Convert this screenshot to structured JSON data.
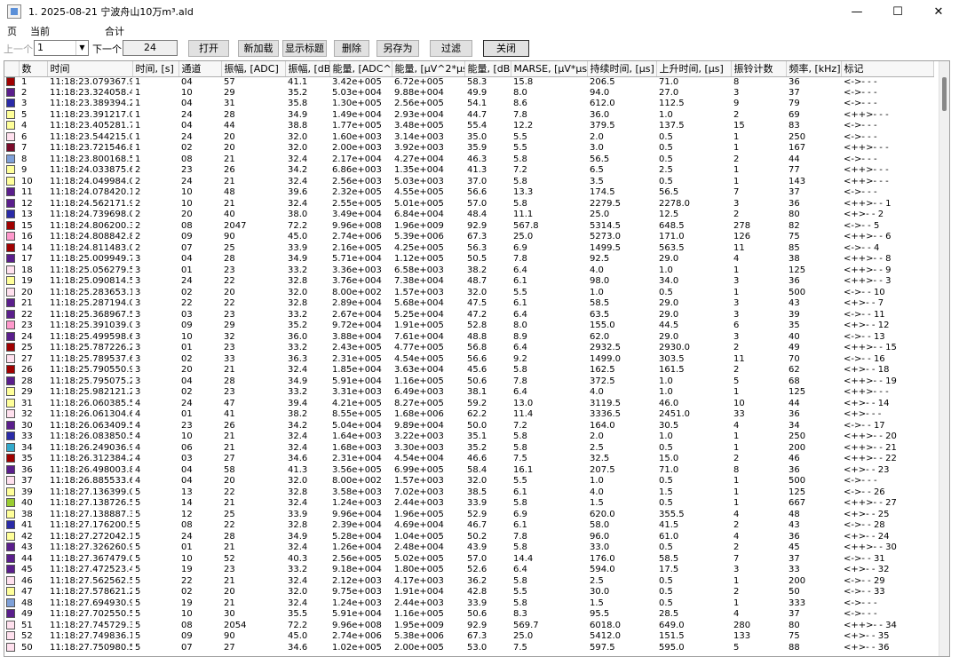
{
  "window": {
    "title": "1. 2025-08-21 宁波舟山10万m³.ald",
    "minimize": "—",
    "maximize": "☐",
    "close": "✕"
  },
  "menu": {
    "page": "页",
    "current": "当前",
    "total": "合计"
  },
  "toolbar": {
    "prev": "上一个",
    "current_value": "1",
    "next": "下一个",
    "total_value": "24",
    "open": "打开",
    "reload": "新加载",
    "show_title": "显示标题",
    "delete": "删除",
    "save_as": "另存为",
    "filter": "过滤",
    "close": "关闭"
  },
  "columns": [
    "数",
    "时间",
    "时间, [s]",
    "通道",
    "振幅, [ADC]",
    "振幅, [dB]",
    "能量, [ADC^2]",
    "能量, [µV^2*µs]",
    "能量, [dB]",
    "MARSE, [µV*µs]",
    "持续时间, [µs]",
    "上升时间, [µs]",
    "振铃计数",
    "频率, [kHz]",
    "标记"
  ],
  "rows": [
    {
      "color": "#a00000",
      "c": [
        "1",
        "11:18:23.079367.9",
        "1",
        "04",
        "57",
        "41.1",
        "3.42e+005",
        "6.72e+005",
        "58.3",
        "15.8",
        "206.5",
        "71.0",
        "8",
        "36",
        "<->- - -"
      ]
    },
    {
      "color": "#5a1e8c",
      "c": [
        "2",
        "11:18:23.324058.4",
        "1",
        "10",
        "29",
        "35.2",
        "5.03e+004",
        "9.88e+004",
        "49.9",
        "8.0",
        "94.0",
        "27.0",
        "3",
        "37",
        "<->- - -"
      ]
    },
    {
      "color": "#2a2aa8",
      "c": [
        "3",
        "11:18:23.389394.2",
        "1",
        "04",
        "31",
        "35.8",
        "1.30e+005",
        "2.56e+005",
        "54.1",
        "8.6",
        "612.0",
        "112.5",
        "9",
        "79",
        "<->- - -"
      ]
    },
    {
      "color": "#ffff99",
      "c": [
        "5",
        "11:18:23.391217.0",
        "1",
        "24",
        "28",
        "34.9",
        "1.49e+004",
        "2.93e+004",
        "44.7",
        "7.8",
        "36.0",
        "1.0",
        "2",
        "69",
        "<++>- - -"
      ]
    },
    {
      "color": "#ffff99",
      "c": [
        "4",
        "11:18:23.405281.7",
        "1",
        "04",
        "44",
        "38.8",
        "1.77e+005",
        "3.48e+005",
        "55.4",
        "12.2",
        "379.5",
        "137.5",
        "15",
        "83",
        "<->- - -"
      ]
    },
    {
      "color": "#ffe0ee",
      "c": [
        "6",
        "11:18:23.544215.0",
        "1",
        "24",
        "20",
        "32.0",
        "1.60e+003",
        "3.14e+003",
        "35.0",
        "5.5",
        "2.0",
        "0.5",
        "1",
        "250",
        "<->- - -"
      ]
    },
    {
      "color": "#7a0a2a",
      "c": [
        "7",
        "11:18:23.721546.8",
        "1",
        "02",
        "20",
        "32.0",
        "2.00e+003",
        "3.92e+003",
        "35.9",
        "5.5",
        "3.0",
        "0.5",
        "1",
        "167",
        "<++>- - -"
      ]
    },
    {
      "color": "#7ea0d8",
      "c": [
        "8",
        "11:18:23.800168.5",
        "1",
        "08",
        "21",
        "32.4",
        "2.17e+004",
        "4.27e+004",
        "46.3",
        "5.8",
        "56.5",
        "0.5",
        "2",
        "44",
        "<->- - -"
      ]
    },
    {
      "color": "#ffff99",
      "c": [
        "9",
        "11:18:24.033875.6",
        "2",
        "23",
        "26",
        "34.2",
        "6.86e+003",
        "1.35e+004",
        "41.3",
        "7.2",
        "6.5",
        "2.5",
        "1",
        "77",
        "<++>- - -"
      ]
    },
    {
      "color": "#ffff99",
      "c": [
        "10",
        "11:18:24.049984.0",
        "2",
        "24",
        "21",
        "32.4",
        "2.56e+003",
        "5.03e+003",
        "37.0",
        "5.8",
        "3.5",
        "0.5",
        "1",
        "143",
        "<++>- - -"
      ]
    },
    {
      "color": "#5a1e8c",
      "c": [
        "11",
        "11:18:24.078420.1",
        "2",
        "10",
        "48",
        "39.6",
        "2.32e+005",
        "4.55e+005",
        "56.6",
        "13.3",
        "174.5",
        "56.5",
        "7",
        "37",
        "<->- - -"
      ]
    },
    {
      "color": "#5a1e8c",
      "c": [
        "12",
        "11:18:24.562171.9",
        "2",
        "10",
        "21",
        "32.4",
        "2.55e+005",
        "5.01e+005",
        "57.0",
        "5.8",
        "2279.5",
        "2278.0",
        "3",
        "36",
        "<++>- - 1"
      ]
    },
    {
      "color": "#2a2aa8",
      "c": [
        "13",
        "11:18:24.739698.0",
        "2",
        "20",
        "40",
        "38.0",
        "3.49e+004",
        "6.84e+004",
        "48.4",
        "11.1",
        "25.0",
        "12.5",
        "2",
        "80",
        "<+>- - 2"
      ]
    },
    {
      "color": "#a00000",
      "c": [
        "15",
        "11:18:24.806200.3",
        "2",
        "08",
        "2047",
        "72.2",
        "9.96e+008",
        "1.96e+009",
        "92.9",
        "567.8",
        "5314.5",
        "648.5",
        "278",
        "82",
        "<->- - 5"
      ]
    },
    {
      "color": "#ff99cc",
      "c": [
        "16",
        "11:18:24.808842.8",
        "2",
        "09",
        "90",
        "45.0",
        "2.74e+006",
        "5.39e+006",
        "67.3",
        "25.0",
        "5273.0",
        "171.0",
        "126",
        "75",
        "<++>- - 6"
      ]
    },
    {
      "color": "#a00000",
      "c": [
        "14",
        "11:18:24.811483.0",
        "2",
        "07",
        "25",
        "33.9",
        "2.16e+005",
        "4.25e+005",
        "56.3",
        "6.9",
        "1499.5",
        "563.5",
        "11",
        "85",
        "<->- - 4"
      ]
    },
    {
      "color": "#5a1e8c",
      "c": [
        "17",
        "11:18:25.009949.7",
        "3",
        "04",
        "28",
        "34.9",
        "5.71e+004",
        "1.12e+005",
        "50.5",
        "7.8",
        "92.5",
        "29.0",
        "4",
        "38",
        "<++>- - 8"
      ]
    },
    {
      "color": "#ffe0ee",
      "c": [
        "18",
        "11:18:25.056279.5",
        "3",
        "01",
        "23",
        "33.2",
        "3.36e+003",
        "6.58e+003",
        "38.2",
        "6.4",
        "4.0",
        "1.0",
        "1",
        "125",
        "<++>- - 9"
      ]
    },
    {
      "color": "#ffff99",
      "c": [
        "19",
        "11:18:25.090814.5",
        "3",
        "24",
        "22",
        "32.8",
        "3.76e+004",
        "7.38e+004",
        "48.7",
        "6.1",
        "98.0",
        "34.0",
        "3",
        "36",
        "<++>- - 3"
      ]
    },
    {
      "color": "#ffe0ee",
      "c": [
        "20",
        "11:18:25.283653.1",
        "3",
        "02",
        "20",
        "32.0",
        "8.00e+002",
        "1.57e+003",
        "32.0",
        "5.5",
        "1.0",
        "0.5",
        "1",
        "500",
        "<->- - 10"
      ]
    },
    {
      "color": "#5a1e8c",
      "c": [
        "21",
        "11:18:25.287194.0",
        "3",
        "22",
        "22",
        "32.8",
        "2.89e+004",
        "5.68e+004",
        "47.5",
        "6.1",
        "58.5",
        "29.0",
        "3",
        "43",
        "<+>- - 7"
      ]
    },
    {
      "color": "#5a1e8c",
      "c": [
        "22",
        "11:18:25.368967.5",
        "3",
        "03",
        "23",
        "33.2",
        "2.67e+004",
        "5.25e+004",
        "47.2",
        "6.4",
        "63.5",
        "29.0",
        "3",
        "39",
        "<->- - 11"
      ]
    },
    {
      "color": "#ff99cc",
      "c": [
        "23",
        "11:18:25.391039.0",
        "3",
        "09",
        "29",
        "35.2",
        "9.72e+004",
        "1.91e+005",
        "52.8",
        "8.0",
        "155.0",
        "44.5",
        "6",
        "35",
        "<+>- - 12"
      ]
    },
    {
      "color": "#5a1e8c",
      "c": [
        "24",
        "11:18:25.499598.6",
        "3",
        "10",
        "32",
        "36.0",
        "3.88e+004",
        "7.61e+004",
        "48.8",
        "8.9",
        "62.0",
        "29.0",
        "3",
        "40",
        "<->- - 13"
      ]
    },
    {
      "color": "#a00000",
      "c": [
        "25",
        "11:18:25.787226.2",
        "3",
        "01",
        "23",
        "33.2",
        "2.43e+005",
        "4.77e+005",
        "56.8",
        "6.4",
        "2932.5",
        "2930.0",
        "2",
        "49",
        "<++>- - 15"
      ]
    },
    {
      "color": "#ffe0ee",
      "c": [
        "27",
        "11:18:25.789537.6",
        "3",
        "02",
        "33",
        "36.3",
        "2.31e+005",
        "4.54e+005",
        "56.6",
        "9.2",
        "1499.0",
        "303.5",
        "11",
        "70",
        "<->- - 16"
      ]
    },
    {
      "color": "#a00000",
      "c": [
        "26",
        "11:18:25.790550.9",
        "3",
        "20",
        "21",
        "32.4",
        "1.85e+004",
        "3.63e+004",
        "45.6",
        "5.8",
        "162.5",
        "161.5",
        "2",
        "62",
        "<+>- - 18"
      ]
    },
    {
      "color": "#5a1e8c",
      "c": [
        "28",
        "11:18:25.795075.2",
        "3",
        "04",
        "28",
        "34.9",
        "5.91e+004",
        "1.16e+005",
        "50.6",
        "7.8",
        "372.5",
        "1.0",
        "5",
        "68",
        "<++>- - 19"
      ]
    },
    {
      "color": "#ffff99",
      "c": [
        "29",
        "11:18:25.982121.2",
        "3",
        "02",
        "23",
        "33.2",
        "3.31e+003",
        "6.49e+003",
        "38.1",
        "6.4",
        "4.0",
        "1.0",
        "1",
        "125",
        "<++>- - -"
      ]
    },
    {
      "color": "#ffff99",
      "c": [
        "31",
        "11:18:26.060385.5",
        "4",
        "24",
        "47",
        "39.4",
        "4.21e+005",
        "8.27e+005",
        "59.2",
        "13.0",
        "3119.5",
        "46.0",
        "10",
        "44",
        "<+>- - 14"
      ]
    },
    {
      "color": "#ffe0ee",
      "c": [
        "32",
        "11:18:26.061304.6",
        "4",
        "01",
        "41",
        "38.2",
        "8.55e+005",
        "1.68e+006",
        "62.2",
        "11.4",
        "3336.5",
        "2451.0",
        "33",
        "36",
        "<+>- - -"
      ]
    },
    {
      "color": "#5a1e8c",
      "c": [
        "30",
        "11:18:26.063409.5",
        "4",
        "23",
        "26",
        "34.2",
        "5.04e+004",
        "9.89e+004",
        "50.0",
        "7.2",
        "164.0",
        "30.5",
        "4",
        "34",
        "<->- - 17"
      ]
    },
    {
      "color": "#2a2aa8",
      "c": [
        "33",
        "11:18:26.083850.5",
        "4",
        "10",
        "21",
        "32.4",
        "1.64e+003",
        "3.22e+003",
        "35.1",
        "5.8",
        "2.0",
        "1.0",
        "1",
        "250",
        "<++>- - 20"
      ]
    },
    {
      "color": "#33aacc",
      "c": [
        "34",
        "11:18:26.249036.9",
        "4",
        "06",
        "21",
        "32.4",
        "1.68e+003",
        "3.30e+003",
        "35.2",
        "5.8",
        "2.5",
        "0.5",
        "1",
        "200",
        "<++>- - 21"
      ]
    },
    {
      "color": "#a00000",
      "c": [
        "35",
        "11:18:26.312384.2",
        "4",
        "03",
        "27",
        "34.6",
        "2.31e+004",
        "4.54e+004",
        "46.6",
        "7.5",
        "32.5",
        "15.0",
        "2",
        "46",
        "<++>- - 22"
      ]
    },
    {
      "color": "#5a1e8c",
      "c": [
        "36",
        "11:18:26.498003.8",
        "4",
        "04",
        "58",
        "41.3",
        "3.56e+005",
        "6.99e+005",
        "58.4",
        "16.1",
        "207.5",
        "71.0",
        "8",
        "36",
        "<+>- - 23"
      ]
    },
    {
      "color": "#ffe0ee",
      "c": [
        "37",
        "11:18:26.885533.6",
        "4",
        "04",
        "20",
        "32.0",
        "8.00e+002",
        "1.57e+003",
        "32.0",
        "5.5",
        "1.0",
        "0.5",
        "1",
        "500",
        "<->- - -"
      ]
    },
    {
      "color": "#ffff99",
      "c": [
        "39",
        "11:18:27.136399.0",
        "5",
        "13",
        "22",
        "32.8",
        "3.58e+003",
        "7.02e+003",
        "38.5",
        "6.1",
        "4.0",
        "1.5",
        "1",
        "125",
        "<->- - 26"
      ]
    },
    {
      "color": "#9acd32",
      "c": [
        "40",
        "11:18:27.138726.5",
        "5",
        "14",
        "21",
        "32.4",
        "1.24e+003",
        "2.44e+003",
        "33.9",
        "5.8",
        "1.5",
        "0.5",
        "1",
        "667",
        "<++>- - 27"
      ]
    },
    {
      "color": "#ffff99",
      "c": [
        "38",
        "11:18:27.138887.3",
        "5",
        "12",
        "25",
        "33.9",
        "9.96e+004",
        "1.96e+005",
        "52.9",
        "6.9",
        "620.0",
        "355.5",
        "4",
        "48",
        "<+>- - 25"
      ]
    },
    {
      "color": "#2a2aa8",
      "c": [
        "41",
        "11:18:27.176200.5",
        "5",
        "08",
        "22",
        "32.8",
        "2.39e+004",
        "4.69e+004",
        "46.7",
        "6.1",
        "58.0",
        "41.5",
        "2",
        "43",
        "<->- - 28"
      ]
    },
    {
      "color": "#ffff99",
      "c": [
        "42",
        "11:18:27.272042.1",
        "5",
        "24",
        "28",
        "34.9",
        "5.28e+004",
        "1.04e+005",
        "50.2",
        "7.8",
        "96.0",
        "61.0",
        "4",
        "36",
        "<+>- - 24"
      ]
    },
    {
      "color": "#5a1e8c",
      "c": [
        "43",
        "11:18:27.326260.9",
        "5",
        "01",
        "21",
        "32.4",
        "1.26e+004",
        "2.48e+004",
        "43.9",
        "5.8",
        "33.0",
        "0.5",
        "2",
        "45",
        "<++>- - 30"
      ]
    },
    {
      "color": "#5a1e8c",
      "c": [
        "44",
        "11:18:27.367479.0",
        "5",
        "10",
        "52",
        "40.3",
        "2.56e+005",
        "5.02e+005",
        "57.0",
        "14.4",
        "176.0",
        "58.5",
        "7",
        "37",
        "<->- - 31"
      ]
    },
    {
      "color": "#5a1e8c",
      "c": [
        "45",
        "11:18:27.472523.4",
        "5",
        "19",
        "23",
        "33.2",
        "9.18e+004",
        "1.80e+005",
        "52.6",
        "6.4",
        "594.0",
        "17.5",
        "3",
        "33",
        "<+>- - 32"
      ]
    },
    {
      "color": "#ffe0ee",
      "c": [
        "46",
        "11:18:27.562562.5",
        "5",
        "22",
        "21",
        "32.4",
        "2.12e+003",
        "4.17e+003",
        "36.2",
        "5.8",
        "2.5",
        "0.5",
        "1",
        "200",
        "<->- - 29"
      ]
    },
    {
      "color": "#ffff99",
      "c": [
        "47",
        "11:18:27.578621.2",
        "5",
        "02",
        "20",
        "32.0",
        "9.75e+003",
        "1.91e+004",
        "42.8",
        "5.5",
        "30.0",
        "0.5",
        "2",
        "50",
        "<->- - 33"
      ]
    },
    {
      "color": "#7ea0d8",
      "c": [
        "48",
        "11:18:27.694930.9",
        "5",
        "19",
        "21",
        "32.4",
        "1.24e+003",
        "2.44e+003",
        "33.9",
        "5.8",
        "1.5",
        "0.5",
        "1",
        "333",
        "<->- - -"
      ]
    },
    {
      "color": "#5a1e8c",
      "c": [
        "49",
        "11:18:27.702550.5",
        "5",
        "10",
        "30",
        "35.5",
        "5.91e+004",
        "1.16e+005",
        "50.6",
        "8.3",
        "95.5",
        "28.5",
        "4",
        "37",
        "<->- - -"
      ]
    },
    {
      "color": "#ffe0ee",
      "c": [
        "51",
        "11:18:27.745729.3",
        "5",
        "08",
        "2054",
        "72.2",
        "9.96e+008",
        "1.95e+009",
        "92.9",
        "569.7",
        "6018.0",
        "649.0",
        "280",
        "80",
        "<++>- - 34"
      ]
    },
    {
      "color": "#ffe0ee",
      "c": [
        "52",
        "11:18:27.749836.1",
        "5",
        "09",
        "90",
        "45.0",
        "2.74e+006",
        "5.38e+006",
        "67.3",
        "25.0",
        "5412.0",
        "151.5",
        "133",
        "75",
        "<+>- - 35"
      ]
    },
    {
      "color": "#ffe0ee",
      "c": [
        "50",
        "11:18:27.750980.5",
        "5",
        "07",
        "27",
        "34.6",
        "1.02e+005",
        "2.00e+005",
        "53.0",
        "7.5",
        "597.5",
        "595.0",
        "5",
        "88",
        "<+>- - 36"
      ]
    }
  ]
}
